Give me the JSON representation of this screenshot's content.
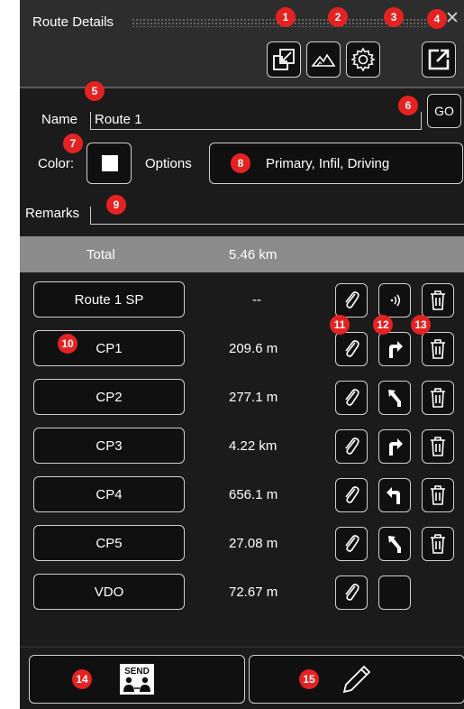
{
  "window": {
    "title": "Route Details",
    "icons": [
      "collapse-chevron-icon",
      "close-icon"
    ]
  },
  "toolbar": {
    "buttons": [
      {
        "badge": "1",
        "icon": "import-icon"
      },
      {
        "badge": "2",
        "icon": "terrain-icon"
      },
      {
        "badge": "3",
        "icon": "settings-gear-icon"
      },
      {
        "badge": "4",
        "icon": "export-icon"
      }
    ]
  },
  "form": {
    "name_label": "Name",
    "name_value": "Route 1",
    "name_badge": "5",
    "go_label": "GO",
    "go_badge": "6",
    "color_label": "Color:",
    "color_badge": "7",
    "color_value": "#ffffff",
    "options_label": "Options",
    "options_value": "Primary, Infil, Driving",
    "options_badge": "8",
    "remarks_label": "Remarks",
    "remarks_value": "",
    "remarks_badge": "9"
  },
  "total": {
    "label": "Total",
    "value": "5.46 km"
  },
  "points": [
    {
      "name": "Route 1 SP",
      "distance": "--",
      "turn": "audio-waves-icon"
    },
    {
      "name": "CP1",
      "distance": "209.6 m",
      "turn": "turn-right-icon"
    },
    {
      "name": "CP2",
      "distance": "277.1 m",
      "turn": "bear-left-icon"
    },
    {
      "name": "CP3",
      "distance": "4.22 km",
      "turn": "turn-right-icon"
    },
    {
      "name": "CP4",
      "distance": "656.1 m",
      "turn": "turn-left-icon"
    },
    {
      "name": "CP5",
      "distance": "27.08 m",
      "turn": "bear-left-icon"
    },
    {
      "name": "VDO",
      "distance": "72.67 m",
      "turn": "none"
    }
  ],
  "point_badges": {
    "list": "10",
    "attach": "11",
    "turn": "12",
    "delete": "13"
  },
  "footer": {
    "send_label": "SEND",
    "send_badge": "14",
    "edit_badge": "15"
  },
  "colors": {
    "panel": "#1b1b1b",
    "badge": "#e52222",
    "total_bar": "#8c8c8c",
    "border": "#d0d0d0"
  }
}
